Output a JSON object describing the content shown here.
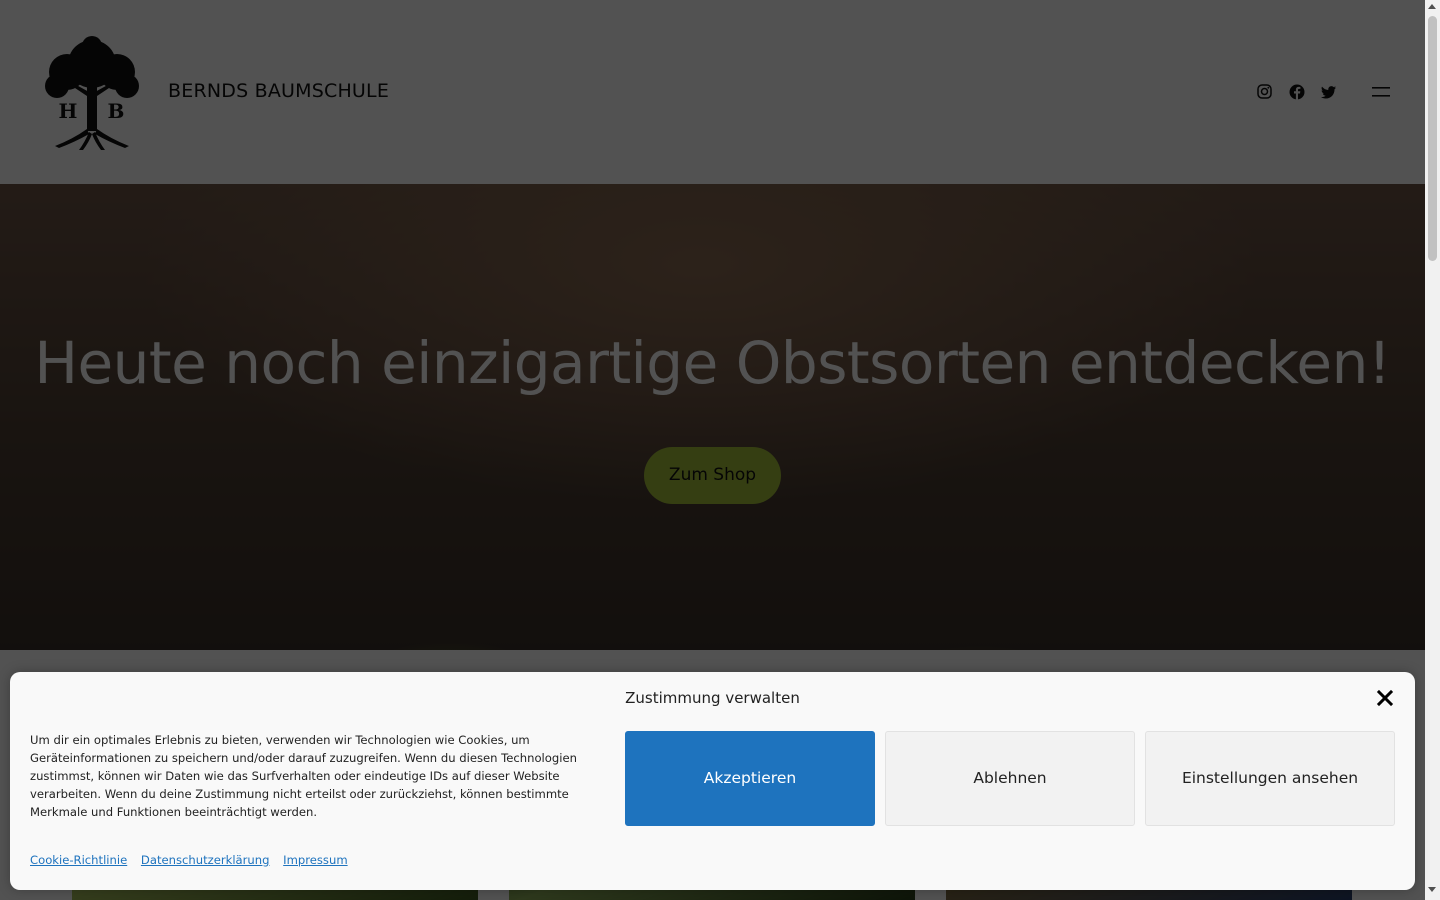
{
  "header": {
    "site_title": "BERNDS BAUMSCHULE",
    "logo_initials": "H B",
    "social": [
      "instagram-icon",
      "facebook-icon",
      "twitter-icon"
    ],
    "menu_icon": "hamburger-menu-icon"
  },
  "hero": {
    "title": "Heute noch einzigartige Obstsorten entdecken!",
    "button_label": "Zum Shop",
    "accent_color": "#a6c13a"
  },
  "consent": {
    "title": "Zustimmung verwalten",
    "text": "Um dir ein optimales Erlebnis zu bieten, verwenden wir Technologien wie Cookies, um Geräteinformationen zu speichern und/oder darauf zuzugreifen. Wenn du diesen Technologien zustimmst, können wir Daten wie das Surfverhalten oder eindeutige IDs auf dieser Website verarbeiten. Wenn du deine Zustimmung nicht erteilst oder zurückziehst, können bestimmte Merkmale und Funktionen beeinträchtigt werden.",
    "links": {
      "cookie_policy": "Cookie-Richtlinie",
      "privacy": "Datenschutzerklärung",
      "imprint": "Impressum"
    },
    "buttons": {
      "accept": "Akzeptieren",
      "deny": "Ablehnen",
      "settings": "Einstellungen ansehen"
    },
    "accept_color": "#1e73be"
  }
}
